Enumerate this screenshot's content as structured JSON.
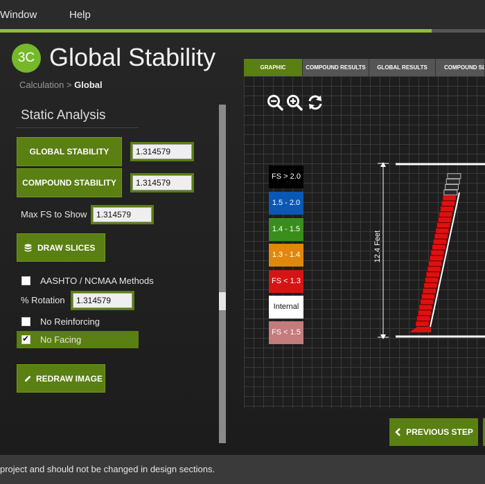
{
  "menu": {
    "items": [
      "Window",
      "Help"
    ]
  },
  "progress": {
    "fraction": 0.89
  },
  "header": {
    "logo_text": "3C",
    "title": "Global Stability"
  },
  "breadcrumb": {
    "parent": "Calculation",
    "separator": ">",
    "current": "Global"
  },
  "panel": {
    "title": "Static Analysis",
    "global_stability": {
      "label": "GLOBAL STABILITY",
      "value": "1.314579"
    },
    "compound_stability": {
      "label": "COMPOUND STABILITY",
      "value": "1.314579"
    },
    "max_fs": {
      "label": "Max FS to Show",
      "value": "1.314579"
    },
    "draw_slices_label": "DRAW SLICES",
    "aashto": {
      "label": "AASHTO / NCMAA Methods",
      "checked": false
    },
    "rotation": {
      "label": "% Rotation",
      "value": "1.314579"
    },
    "no_reinforcing": {
      "label": "No Reinforcing",
      "checked": false
    },
    "no_facing": {
      "label": "No Facing",
      "checked": true
    },
    "redraw_label": "REDRAW IMAGE"
  },
  "tabs": [
    {
      "label": "GRAPHIC",
      "active": true
    },
    {
      "label": "COMPOUND RESULTS",
      "active": false
    },
    {
      "label": "GLOBAL RESULTS",
      "active": false
    },
    {
      "label": "COMPOUND SLI",
      "active": false
    }
  ],
  "toolbar": {
    "icons": [
      "zoom-out-icon",
      "zoom-in-icon",
      "refresh-icon"
    ]
  },
  "legend": [
    {
      "label": "FS > 2.0",
      "color": "#000000",
      "text_color": "#ffffff"
    },
    {
      "label": "1.5 - 2.0",
      "color": "#0b57b4",
      "text_color": "#ffffff"
    },
    {
      "label": "1.4 - 1.5",
      "color": "#3a8d1c",
      "text_color": "#ffffff"
    },
    {
      "label": "1.3 - 1.4",
      "color": "#e0870e",
      "text_color": "#ffffff"
    },
    {
      "label": "FS < 1.3",
      "color": "#d51515",
      "text_color": "#ffffff"
    },
    {
      "label": "Internal",
      "color": "#ffffff",
      "text_color": "#111111"
    },
    {
      "label": "FS < 1.5",
      "color": "#c47b7b",
      "text_color": "#ffffff"
    }
  ],
  "graphic": {
    "height_label": "12.4 Feet"
  },
  "nav": {
    "prev_label": "PREVIOUS STEP"
  },
  "footer": {
    "text": "project and should not be changed in design sections."
  },
  "colors": {
    "accent": "#5a7f12",
    "logo": "#76b82a",
    "slice_red": "#e01010"
  }
}
